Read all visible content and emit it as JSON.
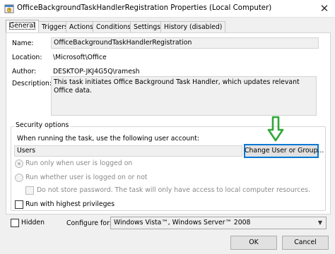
{
  "window": {
    "title": "OfficeBackgroundTaskHandlerRegistration Properties (Local Computer)",
    "close_glyph": "✕"
  },
  "tabs": [
    {
      "label": "General",
      "active": true
    },
    {
      "label": "Triggers"
    },
    {
      "label": "Actions"
    },
    {
      "label": "Conditions"
    },
    {
      "label": "Settings"
    },
    {
      "label": "History (disabled)"
    }
  ],
  "general": {
    "name_label": "Name:",
    "name_value": "OfficeBackgroundTaskHandlerRegistration",
    "location_label": "Location:",
    "location_value": "\\Microsoft\\Office",
    "author_label": "Author:",
    "author_value": "DESKTOP-JKJ4G5Q\\ramesh",
    "description_label": "Description:",
    "description_value": "This task initiates Office Background Task Handler, which updates relevant Office data."
  },
  "security": {
    "group_title": "Security options",
    "account_prompt": "When running the task, use the following user account:",
    "account_value": "Users",
    "change_button": "Change User or Group...",
    "radio_logged_on": "Run only when user is logged on",
    "radio_whether": "Run whether user is logged on or not",
    "no_store_password": "Do not store password.  The task will only have access to local computer resources.",
    "highest_privileges": "Run with highest privileges"
  },
  "footer": {
    "hidden_label": "Hidden",
    "configure_label": "Configure for:",
    "configure_value": "Windows Vista™, Windows Server™ 2008",
    "ok_label": "OK",
    "cancel_label": "Cancel"
  },
  "colors": {
    "arrow_annotation": "#2fa836",
    "focus_border": "#0078d7"
  },
  "icons": {
    "app_icon": "task-scheduler-icon",
    "annotation": "down-arrow-icon"
  }
}
